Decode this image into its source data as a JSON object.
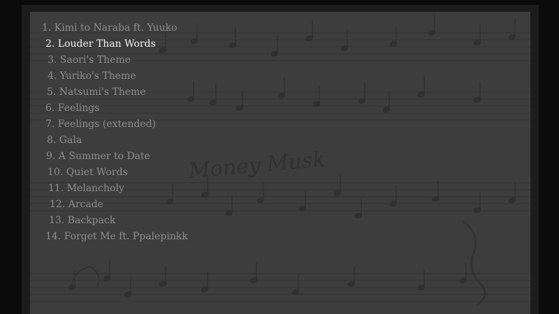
{
  "music_room": {
    "sheet_title": "Money Musk",
    "selected_index": 1,
    "tracks": [
      "1. Kimi to Naraba ft. Yuuko",
      "2. Louder Than Words",
      "3. Saori's Theme",
      "4. Yuriko's Theme",
      "5. Natsumi's Theme",
      "6. Feelings",
      "7. Feelings (extended)",
      "8. Gala",
      "9. A Summer to Date",
      "10. Quiet Words",
      "11. Melancholy",
      "12. Arcade",
      "13. Backpack",
      "14. Forget Me ft. Ppalepinkk"
    ]
  },
  "colors": {
    "background": "#0b0b0b",
    "frame": "#1c1c1c",
    "panel": "#3d3d3d",
    "sheet_ink": "#2e2e2e",
    "track_text": "#8e8e8e",
    "track_selected": "#f2f2f2"
  }
}
